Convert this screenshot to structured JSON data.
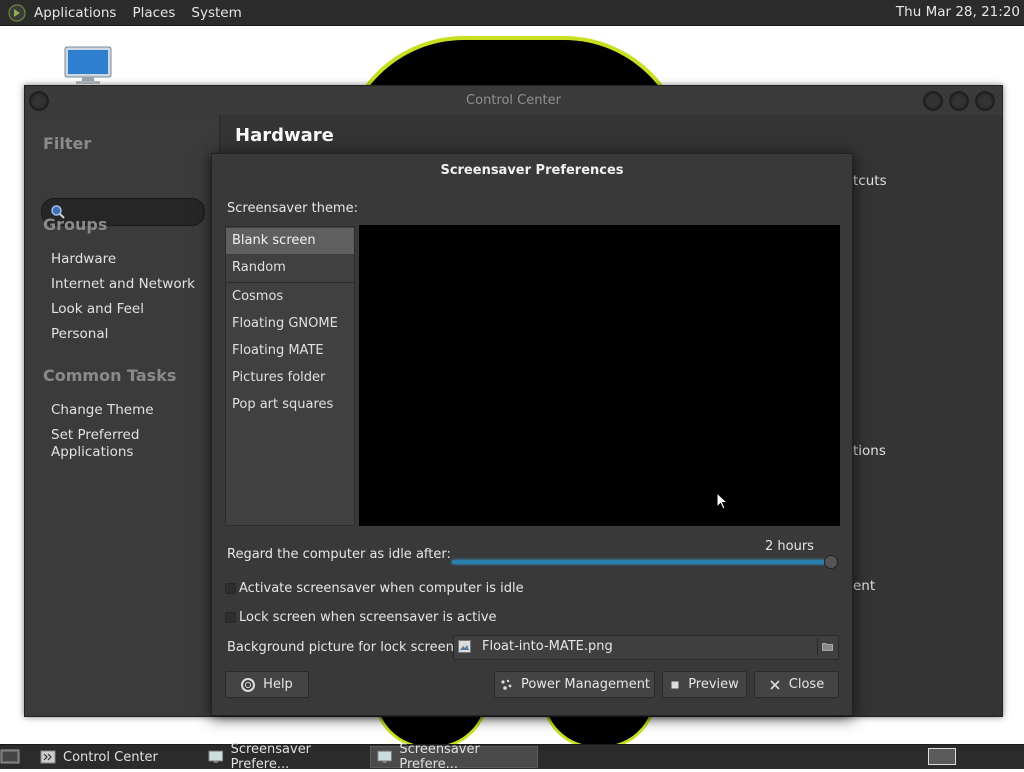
{
  "top_panel": {
    "menus": [
      "Applications",
      "Places",
      "System"
    ],
    "clock": "Thu Mar 28, 21:20"
  },
  "control_center": {
    "title": "Control Center",
    "sidebar": {
      "filter_heading": "Filter",
      "groups_heading": "Groups",
      "groups": [
        "Hardware",
        "Internet and Network",
        "Look and Feel",
        "Personal"
      ],
      "tasks_heading": "Common Tasks",
      "tasks": [
        "Change Theme",
        "Set Preferred Applications"
      ]
    },
    "content": {
      "heading": "Hardware",
      "partial_items": [
        "tcuts",
        "tions",
        "ent"
      ]
    }
  },
  "screensaver_dialog": {
    "title": "Screensaver Preferences",
    "theme_label": "Screensaver theme:",
    "themes": [
      "Blank screen",
      "Random",
      "Cosmos",
      "Floating GNOME",
      "Floating MATE",
      "Pictures folder",
      "Pop art squares"
    ],
    "selected_theme": "Blank screen",
    "idle_label": "Regard the computer as idle after:",
    "idle_value": "2 hours",
    "idle_fraction": 1.0,
    "activate_label": "Activate screensaver when computer is idle",
    "lock_label": "Lock screen when screensaver is active",
    "bg_label": "Background picture for lock screen:",
    "bg_file": "Float-into-MATE.png",
    "buttons": {
      "help": "Help",
      "power": "Power Management",
      "preview": "Preview",
      "close": "Close"
    }
  },
  "taskbar": {
    "tasks": [
      "Control Center",
      "Screensaver Prefere...",
      "Screensaver Prefere..."
    ]
  },
  "colors": {
    "panel": "#2b2b2b",
    "window_bg": "#3b3b3b",
    "accent": "#2a7fae",
    "wallpaper_accent": "#c9e021"
  }
}
